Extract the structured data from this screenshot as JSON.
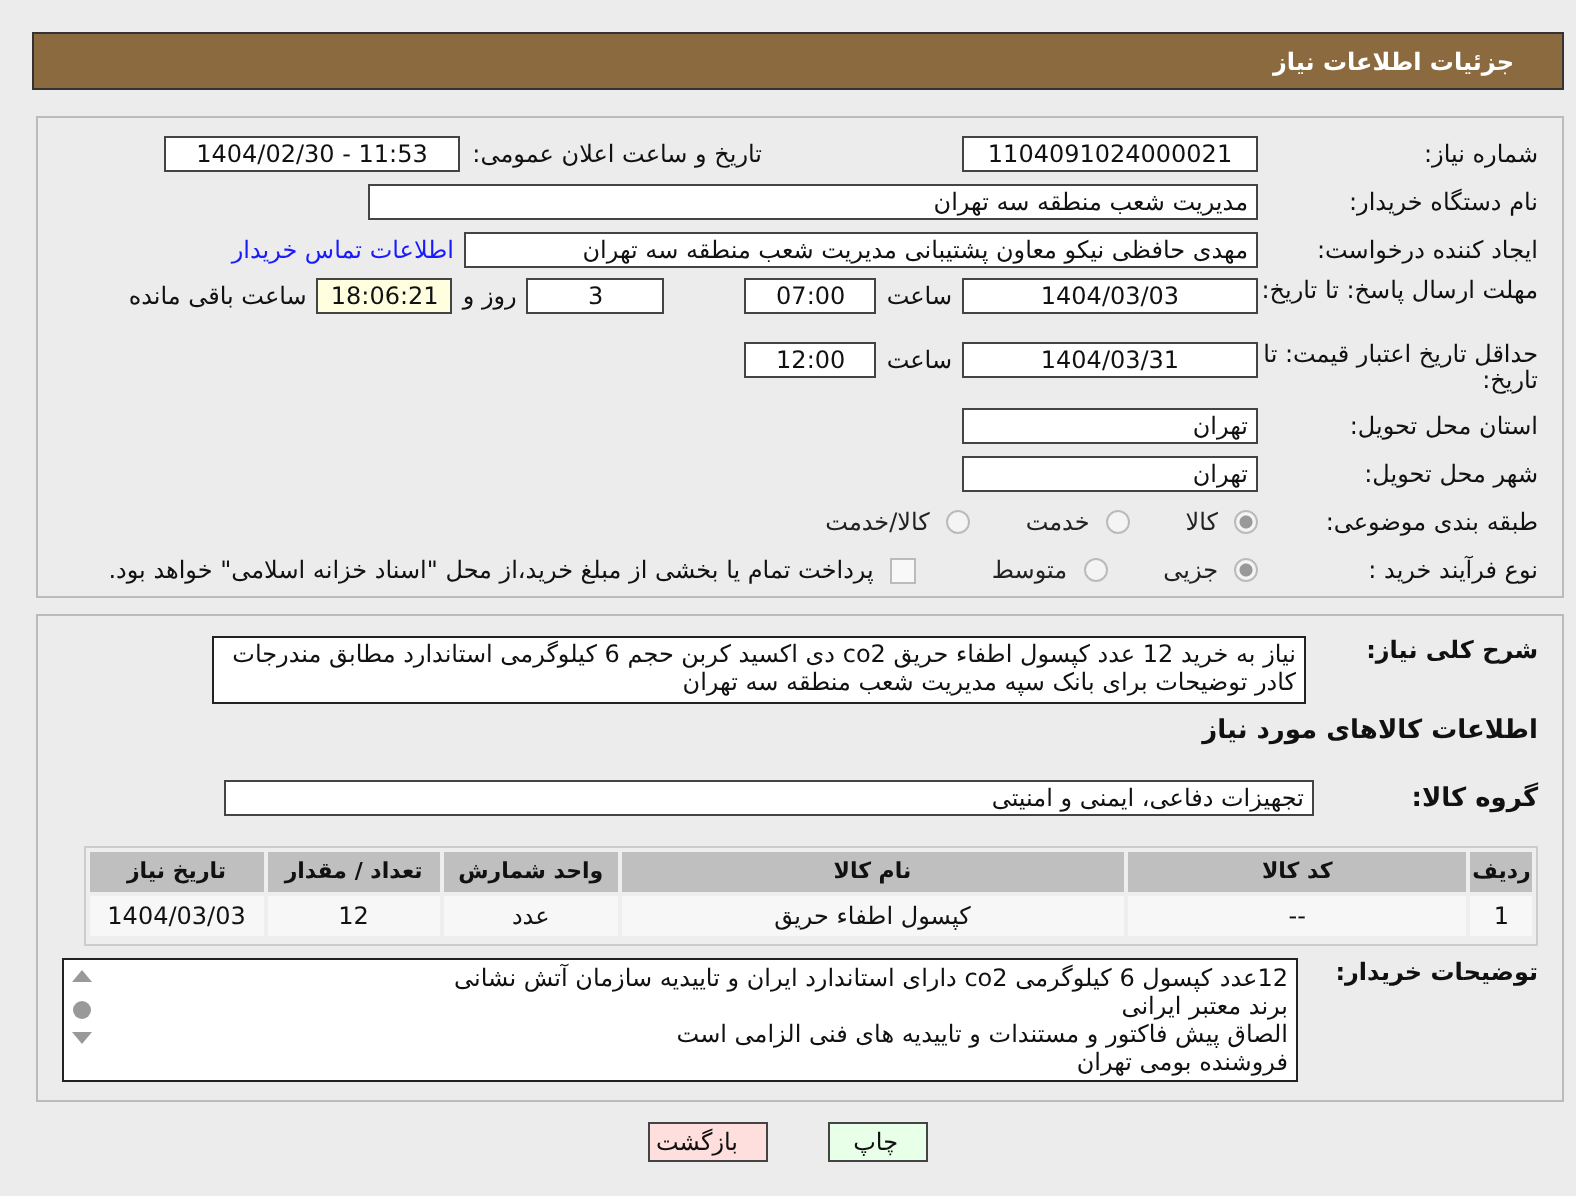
{
  "header": {
    "title": "جزئیات اطلاعات نیاز"
  },
  "need_number": {
    "label": "شماره نیاز:",
    "value": "1104091024000021"
  },
  "announce": {
    "label": "تاریخ و ساعت اعلان عمومی:",
    "value": "1404/02/30 - 11:53"
  },
  "buyer_org": {
    "label": "نام دستگاه خریدار:",
    "value": "مدیریت شعب منطقه سه تهران"
  },
  "requester": {
    "label": "ایجاد کننده درخواست:",
    "value": "مهدی حافظی نیکو معاون پشتیبانی مدیریت شعب منطقه سه تهران",
    "link": "اطلاعات تماس خریدار"
  },
  "reply_deadline": {
    "label": "مهلت ارسال پاسخ: تا تاریخ:",
    "date": "1404/03/03",
    "time_label": "ساعت",
    "time": "07:00",
    "days": "3",
    "days_label": "روز و",
    "remaining": "18:06:21",
    "remaining_label": "ساعت باقی مانده"
  },
  "price_validity": {
    "label": "حداقل تاریخ اعتبار قیمت: تا تاریخ:",
    "date": "1404/03/31",
    "time_label": "ساعت",
    "time": "12:00"
  },
  "province": {
    "label": "استان محل تحویل:",
    "value": "تهران"
  },
  "city": {
    "label": "شهر محل تحویل:",
    "value": "تهران"
  },
  "category": {
    "label": "طبقه بندی موضوعی:",
    "options": [
      {
        "label": "کالا",
        "selected": true
      },
      {
        "label": "خدمت",
        "selected": false
      },
      {
        "label": "کالا/خدمت",
        "selected": false
      }
    ]
  },
  "purchase_type": {
    "label": "نوع فرآیند خرید :",
    "options": [
      {
        "label": "جزیی",
        "selected": true
      },
      {
        "label": "متوسط",
        "selected": false
      }
    ],
    "note": {
      "text": "پرداخت تمام یا بخشی از مبلغ خرید،از محل \"اسناد خزانه اسلامی\" خواهد بود.",
      "checked": false
    }
  },
  "description": {
    "label": "شرح کلی نیاز:",
    "lines": [
      "نیاز به خرید 12 عدد کپسول اطفاء حریق co2 دی اکسید کربن حجم 6 کیلوگرمی استاندارد مطابق مندرجات",
      "کادر توضیحات برای بانک سپه مدیریت شعب منطقه سه تهران"
    ]
  },
  "goods_title": "اطلاعات کالاهای مورد نیاز",
  "goods_group": {
    "label": "گروه کالا:",
    "value": "تجهیزات دفاعی، ایمنی و امنیتی"
  },
  "table": {
    "columns": [
      "ردیف",
      "کد کالا",
      "نام کالا",
      "واحد شمارش",
      "تعداد / مقدار",
      "تاریخ نیاز"
    ],
    "rows": [
      [
        "1",
        "--",
        "کپسول اطفاء حریق",
        "عدد",
        "12",
        "1404/03/03"
      ]
    ]
  },
  "buyer_notes": {
    "label": "توضیحات خریدار:",
    "lines": [
      "12عدد کپسول 6 کیلوگرمی co2 دارای استاندارد ایران و تاییدیه سازمان آتش نشانی",
      "برند معتبر ایرانی",
      "الصاق پیش فاکتور و مستندات و تاییدیه های فنی الزامی است",
      "فروشنده بومی تهران"
    ]
  },
  "buttons": [
    {
      "label": "چاپ",
      "kind": "print"
    },
    {
      "label": "بازگشت",
      "kind": "back"
    }
  ]
}
